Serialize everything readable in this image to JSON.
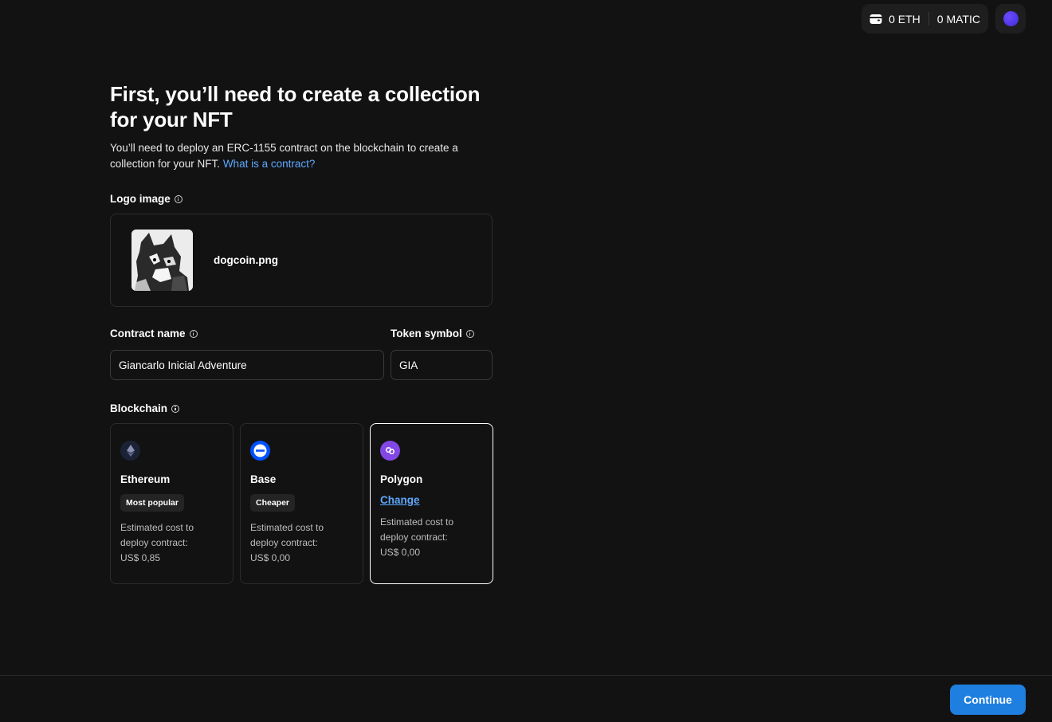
{
  "header": {
    "eth_balance": "0 ETH",
    "matic_balance": "0 MATIC"
  },
  "page": {
    "title": "First, you’ll need to create a collection for your NFT",
    "subtitle_text": "You’ll need to deploy an ERC-1155 contract on the blockchain to create a collection for your NFT.",
    "subtitle_link": "What is a contract?"
  },
  "logo": {
    "label": "Logo image",
    "filename": "dogcoin.png"
  },
  "contract": {
    "name_label": "Contract name",
    "name_value": "Giancarlo Inicial Adventure",
    "symbol_label": "Token symbol",
    "symbol_value": "GIA"
  },
  "blockchain": {
    "label": "Blockchain",
    "options": [
      {
        "name": "Ethereum",
        "badge": "Most popular",
        "cost_line1": "Estimated cost to",
        "cost_line2": "deploy contract:",
        "cost_value": "US$ 0,85"
      },
      {
        "name": "Base",
        "badge": "Cheaper",
        "cost_line1": "Estimated cost to",
        "cost_line2": "deploy contract:",
        "cost_value": "US$ 0,00"
      },
      {
        "name": "Polygon",
        "change_link": "Change",
        "cost_line1": "Estimated cost to",
        "cost_line2": "deploy contract:",
        "cost_value": "US$ 0,00",
        "selected": true
      }
    ]
  },
  "footer": {
    "continue_label": "Continue"
  },
  "colors": {
    "background": "#121212",
    "accent": "#1f7fe0",
    "link": "#5ea8ff",
    "polygon": "#8247e5",
    "base": "#0052ff"
  }
}
